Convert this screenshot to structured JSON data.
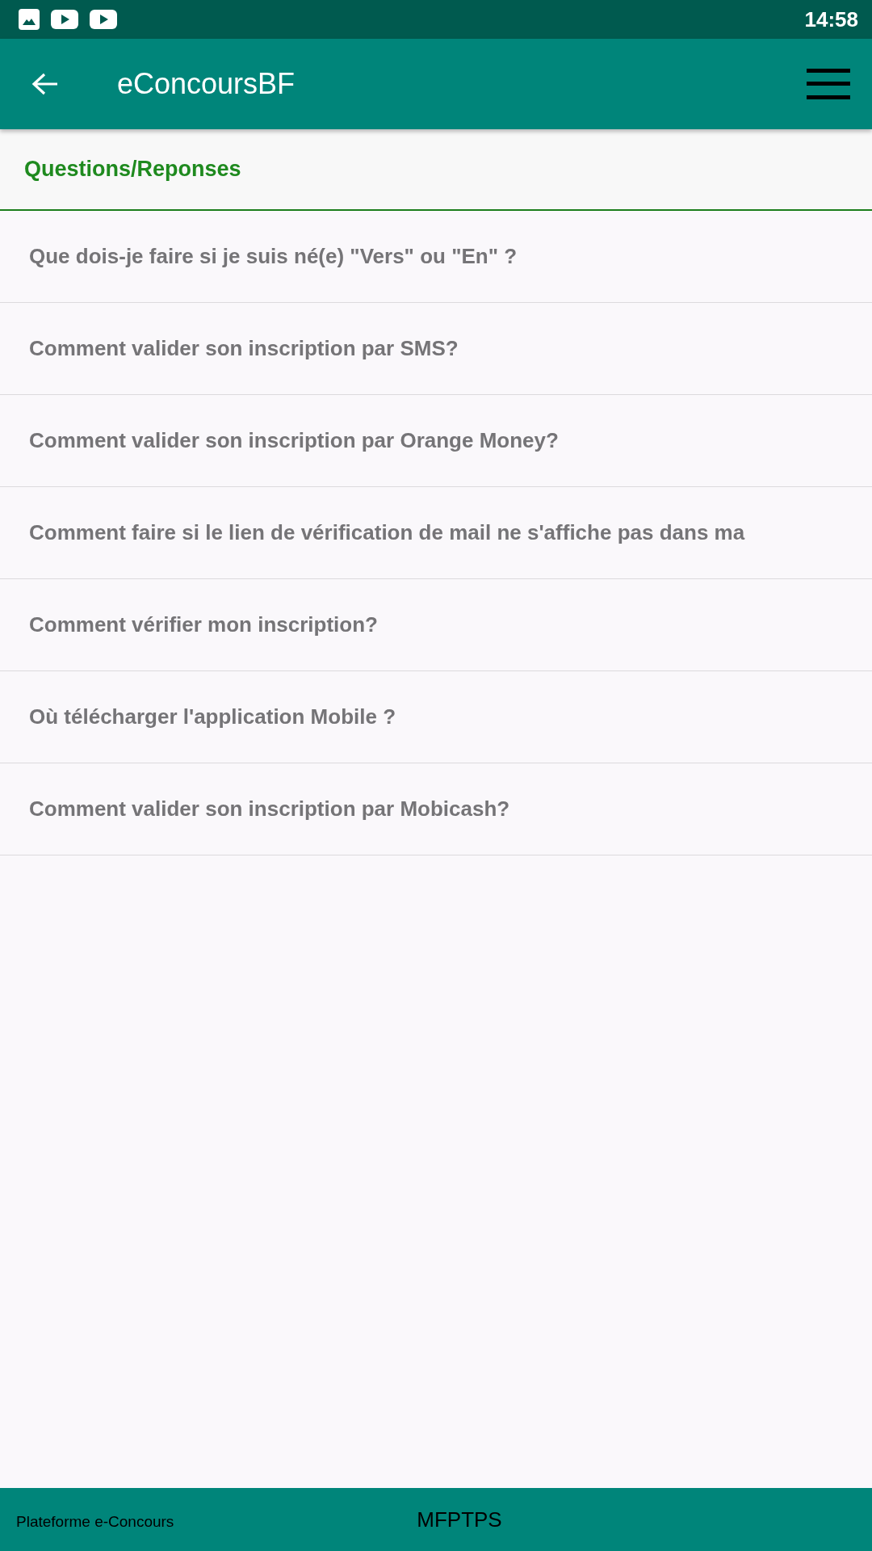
{
  "status_bar": {
    "time": "14:58"
  },
  "app_bar": {
    "title": "eConcoursBF"
  },
  "section": {
    "title": "Questions/Reponses"
  },
  "questions": [
    "Que dois-je faire si je suis né(e) \"Vers\" ou \"En\" ?",
    "Comment valider son inscription par SMS?",
    "Comment valider son inscription par Orange Money?",
    "Comment faire si le lien de vérification de mail ne s'affiche pas dans ma",
    "Comment vérifier mon inscription?",
    "Où télécharger l'application Mobile ?",
    "Comment valider son inscription par Mobicash?"
  ],
  "footer": {
    "platform_label": "Plateforme e-Concours",
    "ministry_label": "MFPTPS"
  }
}
